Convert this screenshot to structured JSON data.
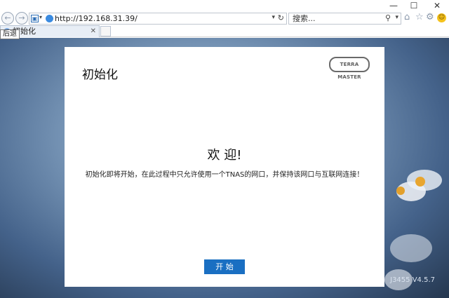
{
  "browser": {
    "url": "http://192.168.31.39/",
    "search_placeholder": "搜索...",
    "tab_title": "初始化",
    "tooltip": "后退",
    "window_controls": {
      "minimize": "—",
      "maximize": "☐",
      "close": "✕"
    }
  },
  "card": {
    "title": "初始化",
    "logo_text": "TERRA MASTER",
    "welcome": "欢 迎!",
    "description": "初始化即将开始，在此过程中只允许使用一个TNAS的网口，并保持该网口与互联网连接！",
    "start_button": "开 始"
  },
  "footer": {
    "version": "J3455 V4.5.7"
  }
}
